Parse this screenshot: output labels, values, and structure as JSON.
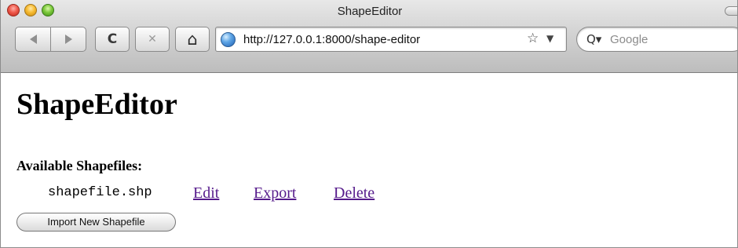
{
  "window": {
    "title": "ShapeEditor"
  },
  "toolbar": {
    "back_icon": "back-arrow-icon",
    "forward_icon": "forward-arrow-icon",
    "reload_glyph": "C",
    "stop_glyph": "✕",
    "home_glyph": "⌂",
    "address": "http://127.0.0.1:8000/shape-editor",
    "bookmark_glyph": "☆",
    "dropdown_glyph": "▼",
    "search_placeholder": "Google",
    "search_glyph": "Q▾"
  },
  "page": {
    "title": "ShapeEditor",
    "section_label": "Available Shapefiles:",
    "shapefiles": [
      {
        "name": "shapefile.shp",
        "actions": [
          "Edit",
          "Export",
          "Delete"
        ]
      }
    ],
    "import_button": "Import New Shapefile"
  },
  "colors": {
    "visited_link": "#551a8b",
    "chrome_top": "#e8e8e8",
    "chrome_bottom": "#bdbdbd"
  }
}
